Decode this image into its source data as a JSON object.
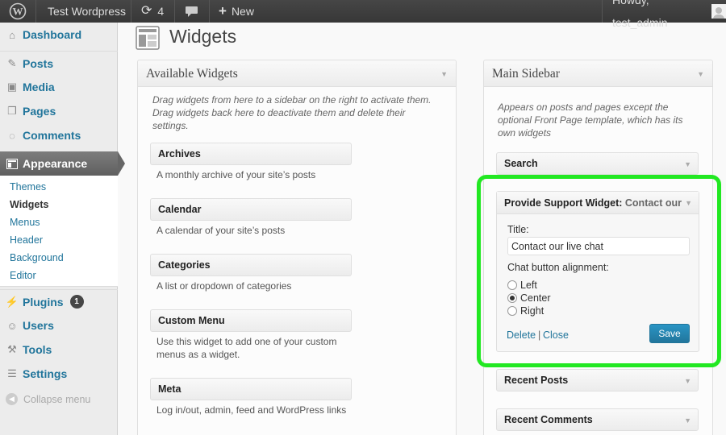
{
  "adminbar": {
    "site_name": "Test Wordpress",
    "updates_count": "4",
    "new_label": "New",
    "howdy": "Howdy, test_admin"
  },
  "menu": {
    "dashboard": "Dashboard",
    "posts": "Posts",
    "media": "Media",
    "pages": "Pages",
    "comments": "Comments",
    "appearance": "Appearance",
    "sub": [
      "Themes",
      "Widgets",
      "Menus",
      "Header",
      "Background",
      "Editor"
    ],
    "plugins": "Plugins",
    "plugins_badge": "1",
    "users": "Users",
    "tools": "Tools",
    "settings": "Settings",
    "collapse": "Collapse menu"
  },
  "page_title": "Widgets",
  "available": {
    "title": "Available Widgets",
    "description": "Drag widgets from here to a sidebar on the right to activate them. Drag widgets back here to deactivate them and delete their settings.",
    "widgets": [
      {
        "name": "Archives",
        "desc": "A monthly archive of your site’s posts"
      },
      {
        "name": "Calendar",
        "desc": "A calendar of your site’s posts"
      },
      {
        "name": "Categories",
        "desc": "A list or dropdown of categories"
      },
      {
        "name": "Custom Menu",
        "desc": "Use this widget to add one of your custom menus as a widget."
      },
      {
        "name": "Meta",
        "desc": "Log in/out, admin, feed and WordPress links"
      }
    ]
  },
  "sidebar": {
    "title": "Main Sidebar",
    "description": "Appears on posts and pages except the optional Front Page template, which has its own widgets",
    "search": "Search",
    "support": {
      "title_bold": "Provide Support Widget:",
      "title_rest": " Contact our live chat",
      "title_label": "Title:",
      "title_value": "Contact our live chat",
      "alignment_label": "Chat button alignment:",
      "options": [
        "Left",
        "Center",
        "Right"
      ],
      "selected": "Center",
      "delete": "Delete",
      "separator": "|",
      "close": "Close",
      "save": "Save"
    },
    "recent_posts": "Recent Posts",
    "recent_comments": "Recent Comments"
  },
  "colors": {
    "highlight": "#22e822",
    "link": "#21759b",
    "adminbar": "#464646"
  }
}
